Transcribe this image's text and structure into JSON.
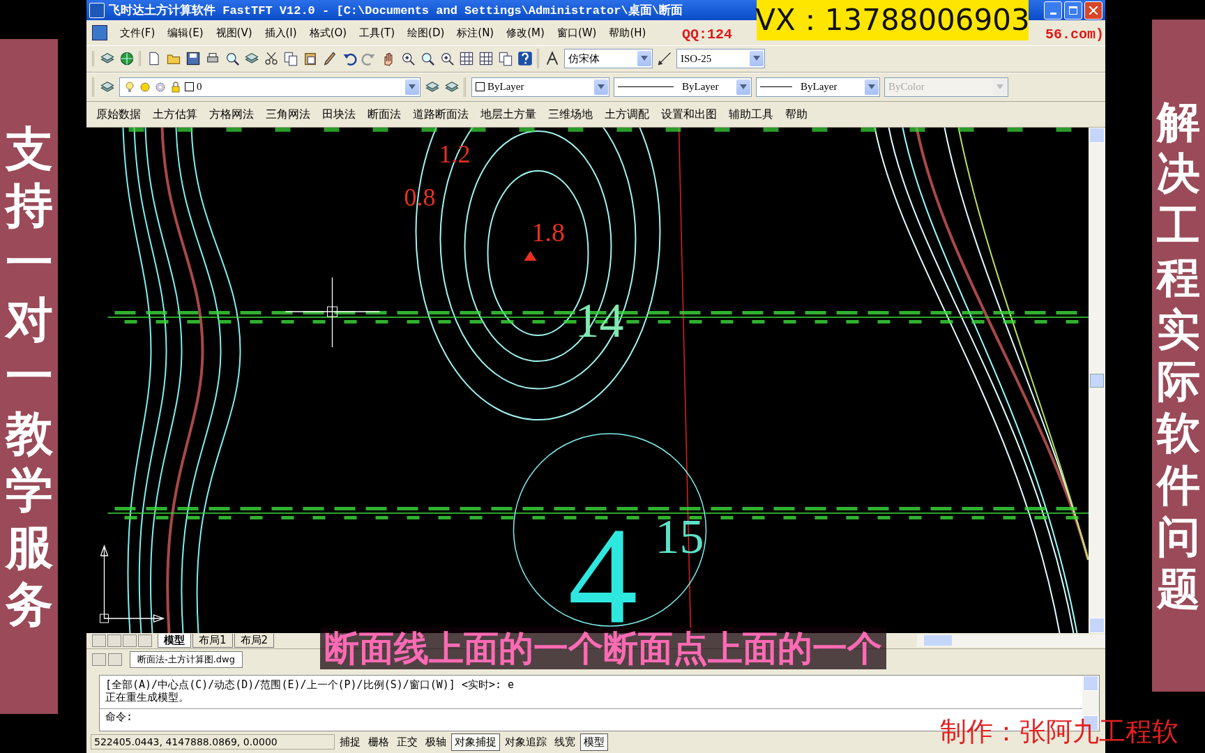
{
  "window": {
    "title": "飞时达土方计算软件 FastTFT V12.0 - [C:\\Documents and Settings\\Administrator\\桌面\\断面"
  },
  "menu": [
    "文件(F)",
    "编辑(E)",
    "视图(V)",
    "插入(I)",
    "格式(O)",
    "工具(T)",
    "绘图(D)",
    "标注(N)",
    "修改(M)",
    "窗口(W)",
    "帮助(H)"
  ],
  "toolbar": {
    "text_style": "仿宋体",
    "dim_style": "ISO-25"
  },
  "properties": {
    "layer": "0",
    "color_control": "ByLayer",
    "linetype": "ByLayer",
    "lineweight": "ByLayer",
    "plot_style": {
      "value": "ByColor",
      "disabled": true
    }
  },
  "app_menu": [
    "原始数据",
    "土方估算",
    "方格网法",
    "三角网法",
    "田块法",
    "断面法",
    "道路断面法",
    "地层土方量",
    "三维场地",
    "土方调配",
    "设置和出图",
    "辅助工具",
    "帮助"
  ],
  "drawing": {
    "labels": [
      {
        "text": "1.2",
        "color": "#e8321e"
      },
      {
        "text": "0.8",
        "color": "#e8321e"
      },
      {
        "text": "1.8",
        "color": "#e8321e"
      },
      {
        "text": "14",
        "color": "#7fe8b0"
      },
      {
        "text": "15",
        "color": "#5fe0c8"
      },
      {
        "text": "4",
        "color": "#2ee8e0"
      }
    ]
  },
  "layout_tabs": [
    {
      "label": "模型",
      "selected": true
    },
    {
      "label": "布局1",
      "selected": false
    },
    {
      "label": "布局2",
      "selected": false
    }
  ],
  "file_tab": "断面法-土方计算图.dwg",
  "command": {
    "history": [
      "[全部(A)/中心点(C)/动态(D)/范围(E)/上一个(P)/比例(S)/窗口(W)] <实时>: e",
      "正在重生成模型。"
    ],
    "prompt": "命令:"
  },
  "status": {
    "coordinates": "522405.0443, 4147888.0869, 0.0000",
    "toggles": [
      {
        "label": "捕捉",
        "on": false
      },
      {
        "label": "栅格",
        "on": false
      },
      {
        "label": "正交",
        "on": false
      },
      {
        "label": "极轴",
        "on": false
      },
      {
        "label": "对象捕捉",
        "on": true
      },
      {
        "label": "对象追踪",
        "on": false
      },
      {
        "label": "线宽",
        "on": false
      },
      {
        "label": "模型",
        "on": true
      }
    ]
  },
  "overlays": {
    "contact": "VX：13788006903",
    "qq_fragment": "QQ:124",
    "site_fragment": "56.com)",
    "subtitle": "断面线上面的一个断面点上面的一个",
    "credit": "制作：张阿九工程软",
    "left_banner": "支持一对一教学服务",
    "right_banner": "解决工程实际软件问题"
  }
}
